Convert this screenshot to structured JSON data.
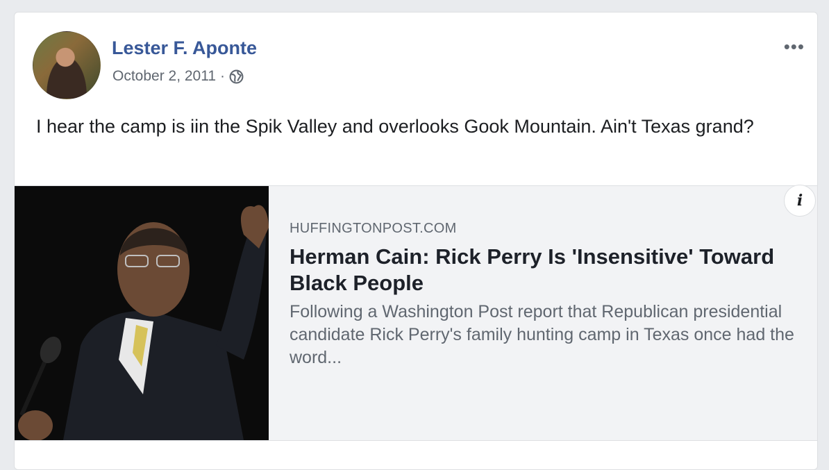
{
  "post": {
    "author_name": "Lester F. Aponte",
    "date": "October 2, 2011",
    "separator": "·",
    "privacy_icon": "globe-icon",
    "more_icon": "ellipsis-icon",
    "more_label": "•••",
    "text": "I hear the camp is iin the Spik Valley and overlooks Gook Mountain. Ain't Texas grand?"
  },
  "link_preview": {
    "domain": "HUFFINGTONPOST.COM",
    "title": "Herman Cain: Rick Perry Is 'Insensitive' Toward Black People",
    "description": "Following a Washington Post report that Republican presidential candidate Rick Perry's family hunting camp in Texas once had the word...",
    "info_label": "i",
    "info_icon": "info-icon"
  },
  "colors": {
    "author_link": "#385898",
    "meta_text": "#606770",
    "preview_bg": "#f2f3f5",
    "page_bg": "#e9ebee"
  }
}
